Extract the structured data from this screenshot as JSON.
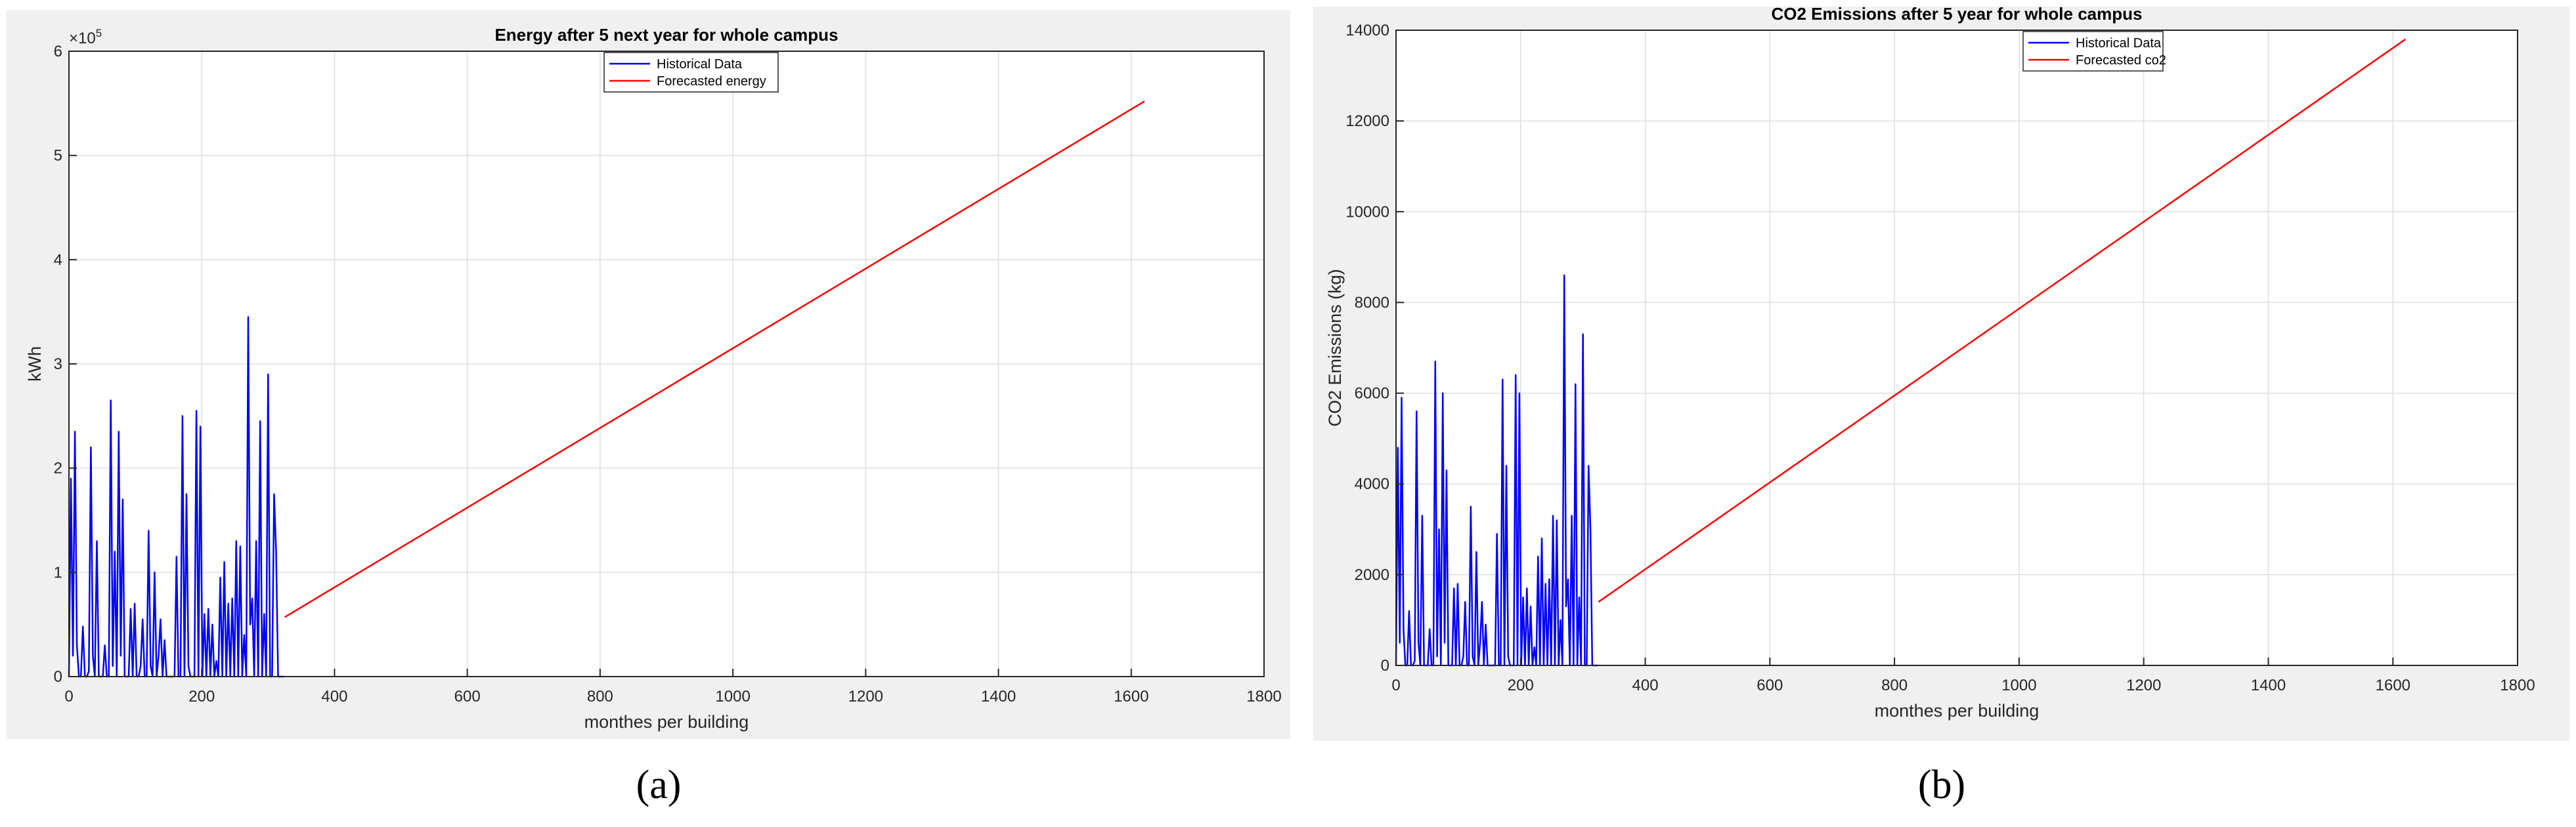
{
  "colors": {
    "historical": "#0000ff",
    "forecast": "#ff0000",
    "panel_bg": "#f0f0f0",
    "grid": "#dfdfdf"
  },
  "captions": {
    "a": "(a)",
    "b": "(b)"
  },
  "chart_data": [
    {
      "type": "line",
      "title": "Energy after 5 next year for whole campus",
      "xlabel": "monthes per building",
      "ylabel": "kWh",
      "y_exponent_label": "×10",
      "y_exponent": "5",
      "xlim": [
        0,
        1800
      ],
      "ylim": [
        0,
        600000
      ],
      "xticks": [
        0,
        200,
        400,
        600,
        800,
        1000,
        1200,
        1400,
        1600,
        1800
      ],
      "yticks": [
        0,
        100000,
        200000,
        300000,
        400000,
        500000,
        600000
      ],
      "ytick_labels": [
        "0",
        "1",
        "2",
        "3",
        "4",
        "5",
        "6"
      ],
      "grid": true,
      "legend": "top-center",
      "series": [
        {
          "name": "Historical Data",
          "color": "#0000ff",
          "x": [
            0,
            3,
            6,
            9,
            12,
            15,
            18,
            21,
            24,
            27,
            30,
            33,
            36,
            39,
            42,
            45,
            48,
            51,
            54,
            57,
            60,
            63,
            66,
            69,
            72,
            75,
            78,
            81,
            84,
            87,
            90,
            93,
            96,
            99,
            102,
            105,
            108,
            111,
            114,
            117,
            120,
            123,
            126,
            129,
            132,
            135,
            138,
            141,
            144,
            147,
            150,
            153,
            156,
            159,
            162,
            165,
            168,
            171,
            174,
            177,
            180,
            183,
            186,
            189,
            192,
            195,
            198,
            201,
            204,
            207,
            210,
            213,
            216,
            219,
            222,
            225,
            228,
            231,
            234,
            237,
            240,
            243,
            246,
            249,
            252,
            255,
            258,
            261,
            264,
            267,
            270,
            273,
            276,
            279,
            282,
            285,
            288,
            291,
            294,
            297,
            300,
            303,
            306,
            309,
            312,
            315,
            318,
            321,
            324
          ],
          "y": [
            0,
            190000,
            20000,
            235000,
            30000,
            0,
            0,
            48000,
            0,
            0,
            5000,
            220000,
            20000,
            0,
            130000,
            0,
            0,
            0,
            30000,
            0,
            0,
            265000,
            10000,
            120000,
            0,
            235000,
            20000,
            170000,
            0,
            0,
            0,
            65000,
            0,
            70000,
            0,
            0,
            10000,
            55000,
            0,
            0,
            140000,
            10000,
            0,
            100000,
            0,
            20000,
            55000,
            0,
            35000,
            0,
            0,
            0,
            0,
            0,
            115000,
            0,
            0,
            250000,
            0,
            175000,
            10000,
            0,
            0,
            0,
            255000,
            0,
            240000,
            0,
            60000,
            0,
            65000,
            0,
            50000,
            0,
            15000,
            0,
            95000,
            0,
            110000,
            0,
            70000,
            0,
            75000,
            0,
            130000,
            0,
            125000,
            0,
            40000,
            0,
            345000,
            50000,
            75000,
            0,
            130000,
            0,
            245000,
            0,
            60000,
            0,
            290000,
            0,
            0,
            175000,
            120000,
            0,
            0,
            0,
            0
          ],
          "note_x_approx": true
        },
        {
          "name": "Forecasted energy",
          "color": "#ff0000",
          "x": [
            325,
            1620
          ],
          "y": [
            57000,
            552000
          ]
        }
      ]
    },
    {
      "type": "line",
      "title": "CO2 Emissions after 5 year for whole campus",
      "xlabel": "monthes per building",
      "ylabel": "CO2 Emissions (kg)",
      "xlim": [
        0,
        1800
      ],
      "ylim": [
        0,
        14000
      ],
      "xticks": [
        0,
        200,
        400,
        600,
        800,
        1000,
        1200,
        1400,
        1600,
        1800
      ],
      "yticks": [
        0,
        2000,
        4000,
        6000,
        8000,
        10000,
        12000,
        14000
      ],
      "ytick_labels": [
        "0",
        "2000",
        "4000",
        "6000",
        "8000",
        "10000",
        "12000",
        "14000"
      ],
      "grid": true,
      "legend": "top-center",
      "series": [
        {
          "name": "Historical Data",
          "color": "#0000ff",
          "x": [
            0,
            3,
            6,
            9,
            12,
            15,
            18,
            21,
            24,
            27,
            30,
            33,
            36,
            39,
            42,
            45,
            48,
            51,
            54,
            57,
            60,
            63,
            66,
            69,
            72,
            75,
            78,
            81,
            84,
            87,
            90,
            93,
            96,
            99,
            102,
            105,
            108,
            111,
            114,
            117,
            120,
            123,
            126,
            129,
            132,
            135,
            138,
            141,
            144,
            147,
            150,
            153,
            156,
            159,
            162,
            165,
            168,
            171,
            174,
            177,
            180,
            183,
            186,
            189,
            192,
            195,
            198,
            201,
            204,
            207,
            210,
            213,
            216,
            219,
            222,
            225,
            228,
            231,
            234,
            237,
            240,
            243,
            246,
            249,
            252,
            255,
            258,
            261,
            264,
            267,
            270,
            273,
            276,
            279,
            282,
            285,
            288,
            291,
            294,
            297,
            300,
            303,
            306,
            309,
            312,
            315,
            318,
            321,
            324
          ],
          "y": [
            0,
            4800,
            500,
            5900,
            800,
            0,
            0,
            1200,
            0,
            0,
            100,
            5600,
            500,
            0,
            3300,
            0,
            0,
            0,
            800,
            0,
            0,
            6700,
            200,
            3000,
            0,
            6000,
            500,
            4300,
            0,
            0,
            0,
            1700,
            0,
            1800,
            0,
            0,
            200,
            1400,
            0,
            0,
            3500,
            200,
            0,
            2500,
            0,
            500,
            1400,
            0,
            900,
            0,
            0,
            0,
            0,
            0,
            2900,
            0,
            0,
            6300,
            0,
            4400,
            200,
            0,
            0,
            0,
            6400,
            0,
            6000,
            0,
            1500,
            0,
            1700,
            0,
            1300,
            0,
            400,
            0,
            2400,
            0,
            2800,
            0,
            1800,
            0,
            1900,
            0,
            3300,
            0,
            3200,
            0,
            1000,
            0,
            8600,
            1300,
            1900,
            0,
            3300,
            0,
            6200,
            0,
            1500,
            0,
            7300,
            0,
            0,
            4400,
            3000,
            0,
            0,
            0,
            0
          ]
        },
        {
          "name": "Forecasted co2",
          "color": "#ff0000",
          "x": [
            325,
            1620
          ],
          "y": [
            1400,
            13800
          ]
        }
      ]
    }
  ]
}
